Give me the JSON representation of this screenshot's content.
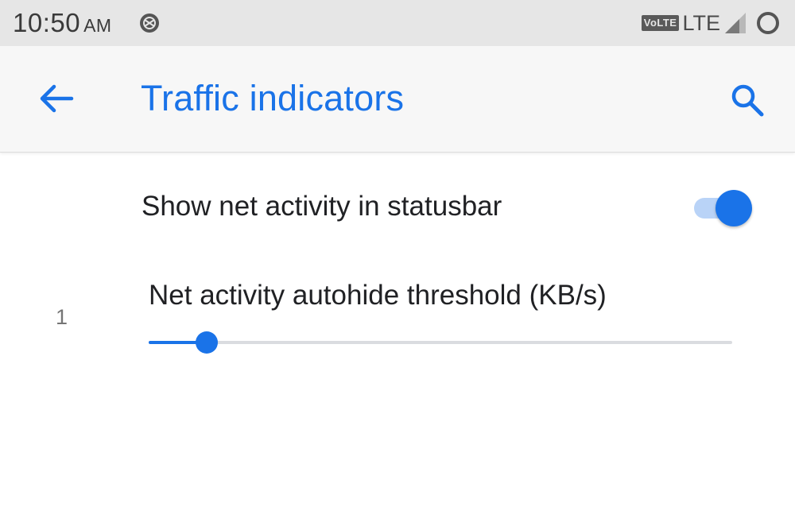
{
  "status_bar": {
    "time": "10:50",
    "ampm": "AM",
    "volte": "VoLTE",
    "network": "LTE",
    "icons": [
      "notification-icon",
      "signal-icon",
      "battery-icon"
    ]
  },
  "app_bar": {
    "title": "Traffic indicators",
    "back_icon": "arrow-left-icon",
    "search_icon": "search-icon"
  },
  "settings": {
    "show_net_activity": {
      "label": "Show net activity in statusbar",
      "enabled": true
    },
    "autohide_threshold": {
      "label": "Net activity autohide threshold (KB/s)",
      "value": "1",
      "slider_fraction": 0.1
    }
  },
  "colors": {
    "accent": "#1a73e8",
    "accent_light": "#b9d3f7",
    "status_bar_bg": "#e6e6e6",
    "app_bar_bg": "#f7f7f7"
  }
}
